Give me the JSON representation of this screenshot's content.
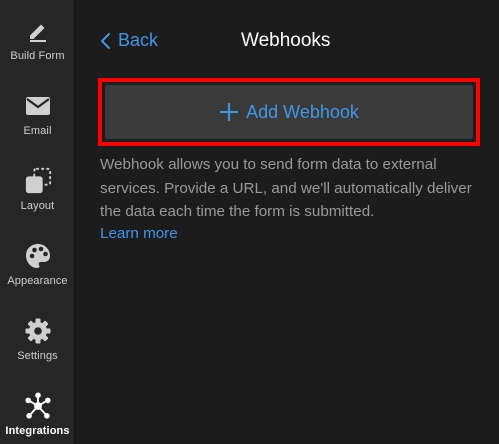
{
  "sidebar": {
    "items": [
      {
        "label": "Build Form",
        "icon": "pencil-icon"
      },
      {
        "label": "Email",
        "icon": "envelope-icon"
      },
      {
        "label": "Layout",
        "icon": "layout-icon"
      },
      {
        "label": "Appearance",
        "icon": "palette-icon"
      },
      {
        "label": "Settings",
        "icon": "gear-icon"
      },
      {
        "label": "Integrations",
        "icon": "integrations-icon",
        "active": true
      }
    ]
  },
  "header": {
    "back_label": "Back",
    "title": "Webhooks"
  },
  "main": {
    "add_button_label": "Add Webhook",
    "description": "Webhook allows you to send form data to external services. Provide a URL, and we'll automatically deliver the data each time the form is submitted.",
    "learn_more": "Learn more"
  },
  "colors": {
    "accent": "#3f97e8",
    "highlight_border": "#ff0000",
    "sidebar_bg": "#262626",
    "main_bg": "#1c1c1c"
  }
}
